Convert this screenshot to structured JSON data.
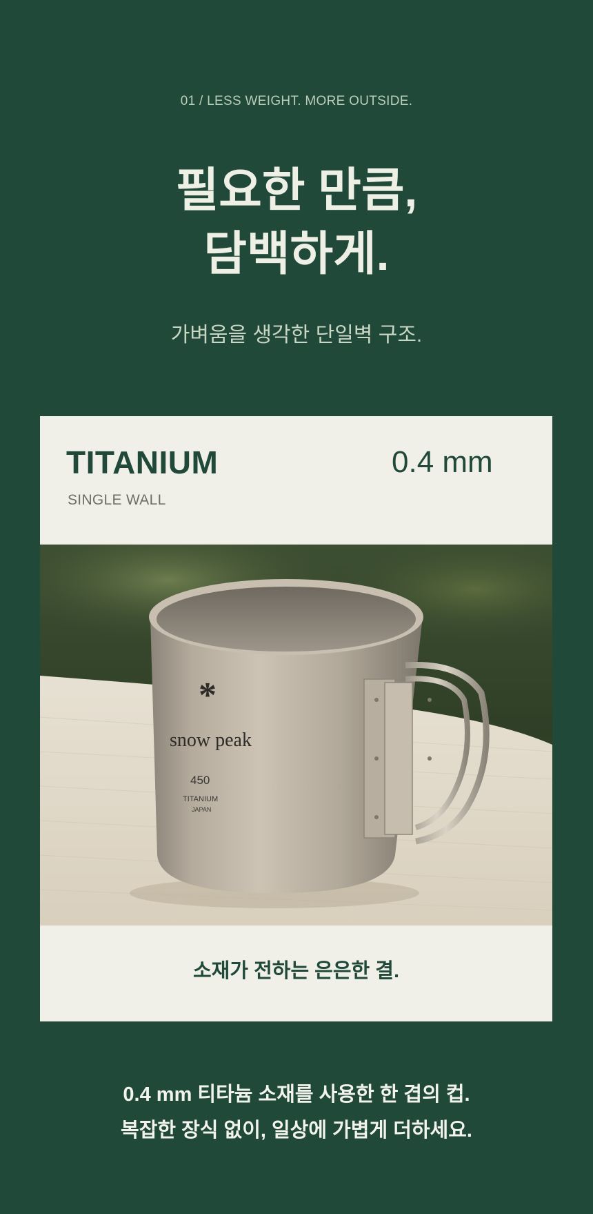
{
  "section": {
    "eyebrow": "01 / LESS WEIGHT. MORE OUTSIDE.",
    "headline_line1": "필요한 만큼,",
    "headline_line2": "담백하게.",
    "subhead": "가벼움을 생각한 단일벽 구조."
  },
  "card": {
    "material": "TITANIUM",
    "structure": "SINGLE WALL",
    "thickness": "0.4 mm",
    "caption": "소재가 전하는 은은한 결.",
    "photo": {
      "brand": "snow peak",
      "capacity": "450",
      "material_mark": "TITANIUM",
      "origin": "JAPAN"
    }
  },
  "footer": {
    "line1": "0.4 mm 티타늄 소재를 사용한 한 겹의 컵.",
    "line2": "복잡한 장식 없이, 일상에 가볍게 더하세요."
  },
  "colors": {
    "background": "#21493a",
    "card": "#f0f0e8",
    "accent": "#21493a",
    "light_text": "#eef0e6"
  }
}
